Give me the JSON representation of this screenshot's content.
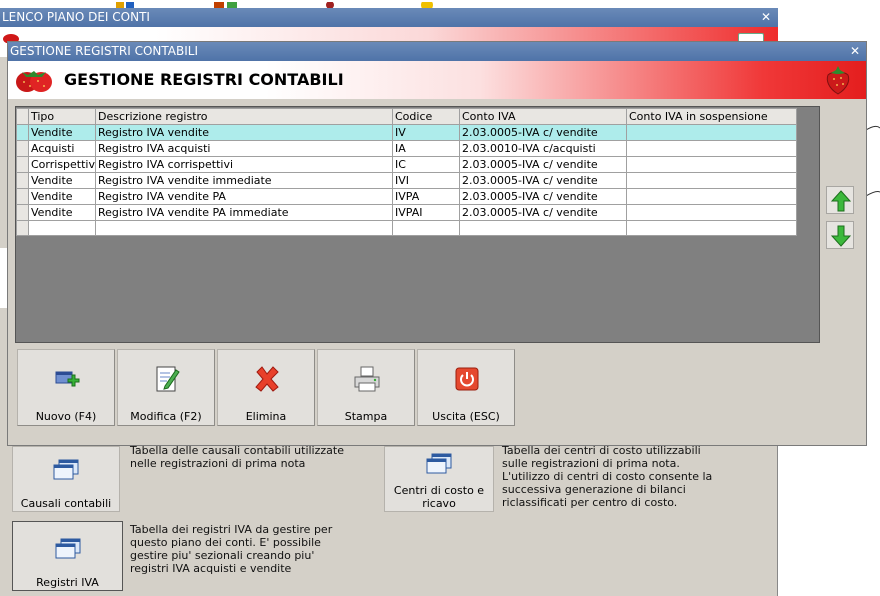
{
  "background_window": {
    "title": "LENCO PIANO DEI CONTI",
    "close_glyph": "✕",
    "banner_icon": "window-icon",
    "tiles": [
      {
        "label": "Causali contabili",
        "icon": "window-stack-icon",
        "description": "Tabella delle causali contabili utilizzate nelle registrazioni di prima nota"
      },
      {
        "label": "Centri di costo e ricavo",
        "icon": "window-stack-icon",
        "description": "Tabella dei centri di costo utilizzabili sulle registrazioni di prima nota. L'utilizzo di centri di costo consente la successiva generazione di bilanci riclassificati per centro di costo."
      },
      {
        "label": "Registri IVA",
        "icon": "window-stack-icon",
        "description": "Tabella dei registri IVA da gestire per questo piano dei conti. E' possibile gestire piu' sezionali creando piu' registri IVA acquisti e vendite"
      }
    ]
  },
  "dialog": {
    "window_title": "GESTIONE REGISTRI CONTABILI",
    "banner_title": "GESTIONE REGISTRI CONTABILI",
    "close_glyph": "✕",
    "logo_icon": "strawberry-icon",
    "accent_red": "#e41e1e",
    "title_bar_color": "#5a7db0"
  },
  "grid": {
    "columns": [
      "Tipo",
      "Descrizione registro",
      "Codice",
      "Conto IVA",
      "Conto IVA in sospensione"
    ],
    "rows": [
      [
        "Vendite",
        "Registro IVA vendite",
        "IV",
        "2.03.0005-IVA c/ vendite",
        ""
      ],
      [
        "Acquisti",
        "Registro IVA acquisti",
        "IA",
        "2.03.0010-IVA c/acquisti",
        ""
      ],
      [
        "Corrispettivi",
        "Registro IVA corrispettivi",
        "IC",
        "2.03.0005-IVA c/ vendite",
        ""
      ],
      [
        "Vendite",
        "Registro IVA vendite immediate",
        "IVI",
        "2.03.0005-IVA c/ vendite",
        ""
      ],
      [
        "Vendite",
        "Registro IVA vendite PA",
        "IVPA",
        "2.03.0005-IVA c/ vendite",
        ""
      ],
      [
        "Vendite",
        "Registro IVA vendite PA immediate",
        "IVPAI",
        "2.03.0005-IVA c/ vendite",
        ""
      ]
    ],
    "selected_row_color": "#aeeceb"
  },
  "side_buttons": [
    {
      "name": "move-up",
      "icon": "arrow-up-icon"
    },
    {
      "name": "move-down",
      "icon": "arrow-down-icon"
    }
  ],
  "toolbar": {
    "buttons": [
      {
        "label": "Nuovo (F4)",
        "icon": "new-record-icon"
      },
      {
        "label": "Modifica (F2)",
        "icon": "edit-document-icon"
      },
      {
        "label": "Elimina",
        "icon": "delete-x-icon"
      },
      {
        "label": "Stampa",
        "icon": "printer-icon"
      },
      {
        "label": "Uscita (ESC)",
        "icon": "exit-power-icon"
      }
    ]
  }
}
